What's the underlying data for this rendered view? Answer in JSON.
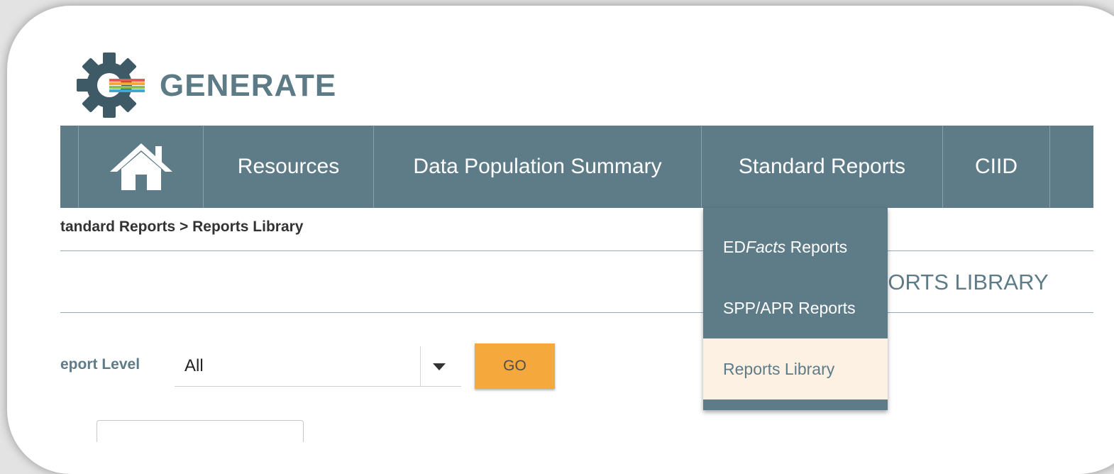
{
  "brand": {
    "name": "GENERATE",
    "colors": {
      "primary": "#5e7b88",
      "accent": "#f5a93c",
      "active_bg": "#fdf1e3"
    }
  },
  "nav": {
    "home_icon": "home-icon",
    "items": [
      {
        "label": "Resources"
      },
      {
        "label": "Data Population Summary"
      },
      {
        "label": "Standard Reports"
      },
      {
        "label": "CIID"
      }
    ]
  },
  "dropdown": {
    "items": [
      {
        "prefix": "ED",
        "emph": "Facts",
        "suffix": " Reports"
      },
      {
        "label": "SPP/APR Reports"
      },
      {
        "label": "Reports Library",
        "active": true
      }
    ]
  },
  "breadcrumb": "tandard Reports > Reports Library",
  "page_heading": "EPORTS LIBRARY",
  "filter": {
    "label": "eport Level",
    "value": "All",
    "go_label": "GO"
  }
}
